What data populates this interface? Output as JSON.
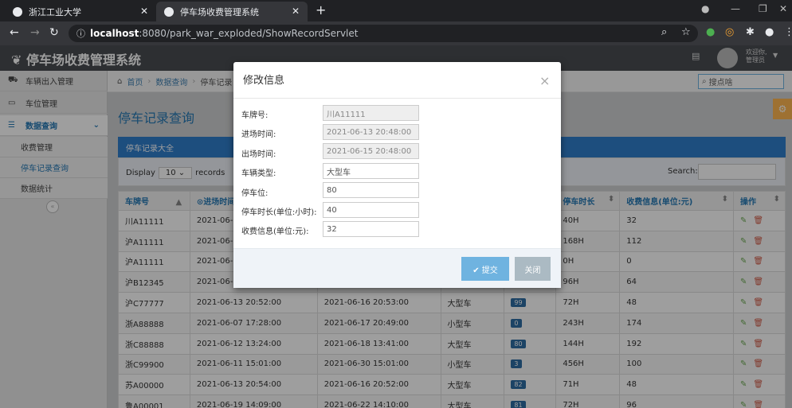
{
  "browser": {
    "tabs": [
      {
        "label": "浙江工业大学"
      },
      {
        "label": "停车场收费管理系统"
      }
    ],
    "url_host": "localhost",
    "url_rest": ":8080/park_war_exploded/ShowRecordServlet"
  },
  "app": {
    "brand": "停车场收费管理系统",
    "user_greeting": "欢迎你,",
    "user_name": "管理员"
  },
  "sidebar": {
    "items": [
      {
        "label": "车辆出入管理",
        "icon": "car-icon"
      },
      {
        "label": "车位管理",
        "icon": "monitor-icon"
      },
      {
        "label": "数据查询",
        "icon": "list-icon"
      },
      {
        "label": "收费管理",
        "icon": ""
      },
      {
        "label": "停车记录查询",
        "icon": ""
      },
      {
        "label": "数据统计",
        "icon": ""
      }
    ]
  },
  "breadcrumb": {
    "home": "首页",
    "sep": "›",
    "level2": "数据查询",
    "level3": "停车记录"
  },
  "search": {
    "placeholder": "搜点啥"
  },
  "page": {
    "title": "停车记录查询",
    "panel_title": "停车记录大全",
    "display_label": "Display",
    "display_value": "10",
    "records_label": "records",
    "search_label": "Search:"
  },
  "table": {
    "headers": [
      "车牌号",
      "⊙进场时间",
      "",
      "",
      "",
      "停车时长",
      "收费信息(单位:元)",
      "操作"
    ],
    "rows": [
      {
        "plate": "川A11111",
        "in": "2021-06-1",
        "out": "",
        "type": "",
        "spot": "",
        "dur": "40H",
        "fee": "32"
      },
      {
        "plate": "沪A11111",
        "in": "2021-06-0",
        "out": "",
        "type": "",
        "spot": "",
        "dur": "168H",
        "fee": "112"
      },
      {
        "plate": "沪A11111",
        "in": "2021-06-1",
        "out": "",
        "type": "",
        "spot": "",
        "dur": "0H",
        "fee": "0"
      },
      {
        "plate": "沪B12345",
        "in": "2021-06-1",
        "out": "",
        "type": "",
        "spot": "",
        "dur": "96H",
        "fee": "64"
      },
      {
        "plate": "沪C77777",
        "in": "2021-06-13 20:52:00",
        "out": "2021-06-16 20:53:00",
        "type": "大型车",
        "spot": "99",
        "dur": "72H",
        "fee": "48"
      },
      {
        "plate": "浙A88888",
        "in": "2021-06-07 17:28:00",
        "out": "2021-06-17 20:49:00",
        "type": "小型车",
        "spot": "0",
        "dur": "243H",
        "fee": "174"
      },
      {
        "plate": "浙C88888",
        "in": "2021-06-12 13:24:00",
        "out": "2021-06-18 13:41:00",
        "type": "大型车",
        "spot": "80",
        "dur": "144H",
        "fee": "192"
      },
      {
        "plate": "浙C99900",
        "in": "2021-06-11 15:01:00",
        "out": "2021-06-30 15:01:00",
        "type": "小型车",
        "spot": "3",
        "dur": "456H",
        "fee": "100"
      },
      {
        "plate": "苏A00000",
        "in": "2021-06-13 20:54:00",
        "out": "2021-06-16 20:52:00",
        "type": "大型车",
        "spot": "82",
        "dur": "71H",
        "fee": "48"
      },
      {
        "plate": "鲁A00001",
        "in": "2021-06-19 14:09:00",
        "out": "2021-06-22 14:10:00",
        "type": "大型车",
        "spot": "81",
        "dur": "72H",
        "fee": "96"
      }
    ]
  },
  "modal": {
    "title": "修改信息",
    "close": "×",
    "fields": [
      {
        "label": "车牌号:",
        "value": "川A11111"
      },
      {
        "label": "进场时间:",
        "value": "2021-06-13 20:48:00"
      },
      {
        "label": "出场时间:",
        "value": "2021-06-15 20:48:00"
      },
      {
        "label": "车辆类型:",
        "value": "大型车"
      },
      {
        "label": "停车位:",
        "value": "80"
      },
      {
        "label": "停车时长(单位:小时):",
        "value": "40"
      },
      {
        "label": "收费信息(单位:元):",
        "value": "32"
      }
    ],
    "submit_label": "✔ 提交",
    "cancel_label": "关闭"
  },
  "colors": {
    "accent": "#307ecc",
    "navbar": "#4a4d52",
    "submit": "#6fb3e0",
    "cancel": "#abbac3"
  }
}
